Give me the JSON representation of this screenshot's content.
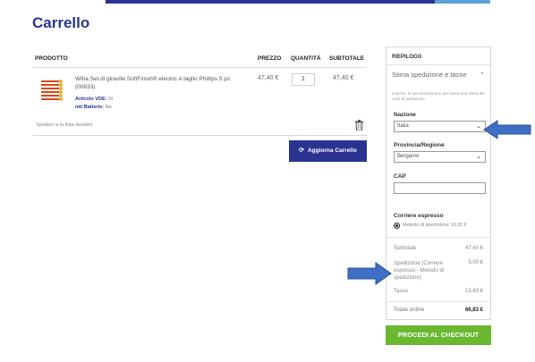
{
  "page": {
    "title": "Carrello"
  },
  "colors": {
    "brand": "#2a3490",
    "accent_bar": "#5aa4d8",
    "checkout": "#6ab82f",
    "arrow": "#3f6fc4"
  },
  "cart": {
    "headers": {
      "product": "PRODOTTO",
      "price": "PREZZO",
      "quantity": "QUANTITÀ",
      "subtotal": "SUBTOTALE"
    },
    "item": {
      "name": "Wiha Set di giravite SoftFinish® electric A taglio Phillips 5 pz. (00833)",
      "attr1_label": "Articolo VDE:",
      "attr1_value": "Sì",
      "attr2_label": "mit Batterie:",
      "attr2_value": "No",
      "price": "47,40 €",
      "quantity": "1",
      "subtotal": "47,40 €"
    },
    "gift_text": "Spedisci a la lista desideri",
    "trash_icon": "trash-icon",
    "update_button": "Aggiorna Carrello",
    "update_icon": "refresh-icon"
  },
  "summary": {
    "title": "RIEPILOGO",
    "estimate_title": "Stima spedizione e tasse",
    "estimate_desc": "Inserisci la tua destinazione per avere una stima dei costi di spedizione.",
    "country_label": "Nazione",
    "country_value": "Italia",
    "province_label": "Provincia/Regione",
    "province_value": "Bergamo",
    "cap_label": "CAP",
    "cap_value": "",
    "carrier_title": "Corriere espresso",
    "carrier_option": "Metodo di spedizione 19,20 €",
    "subtotal_label": "Subtotale",
    "subtotal_value": "47,40 €",
    "shipping_label": "Spedizione (Corriere espresso - Metodo di spedizione)",
    "shipping_value": "5,00 €",
    "tax_label": "Tassa",
    "tax_value": "13,43 €",
    "total_label": "Totale ordine",
    "total_value": "66,83 €",
    "checkout_button": "PROCEDI AL CHECKOUT"
  }
}
